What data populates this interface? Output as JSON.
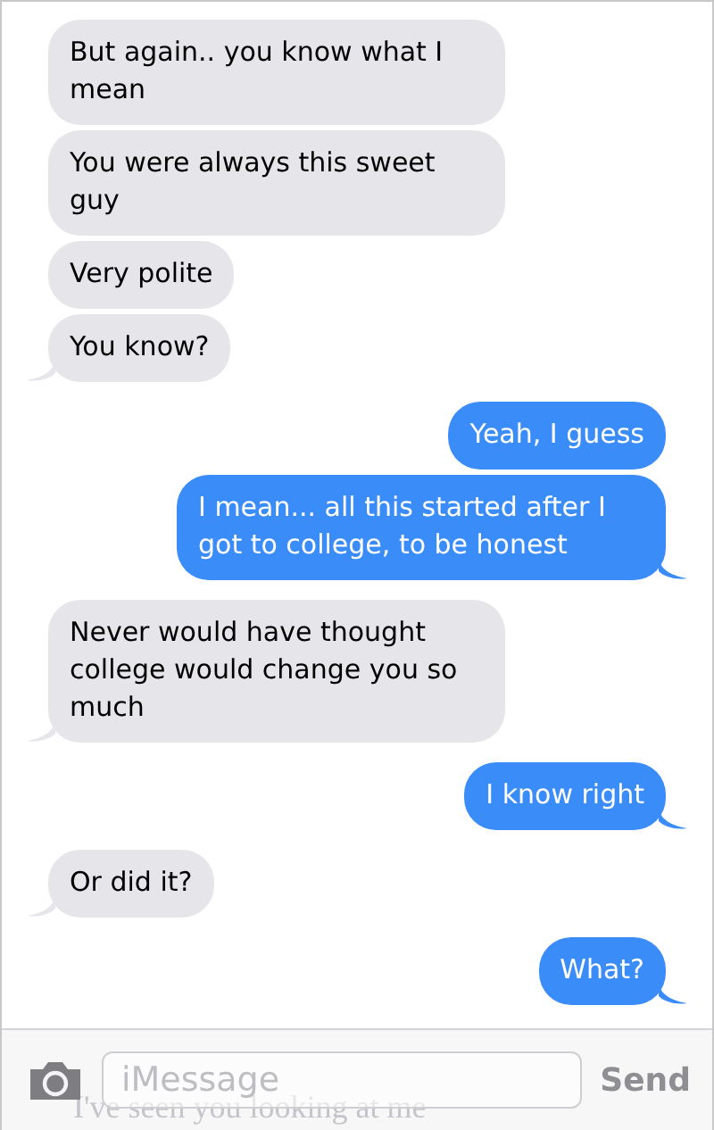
{
  "messages": [
    {
      "sent": false,
      "text": "But again.. you know what I mean",
      "tail": false
    },
    {
      "sent": false,
      "text": "You were always this sweet guy",
      "tail": false
    },
    {
      "sent": false,
      "text": "Very polite",
      "tail": false
    },
    {
      "sent": false,
      "text": "You know?",
      "tail": true
    },
    {
      "sent": true,
      "text": "Yeah, I guess",
      "tail": false
    },
    {
      "sent": true,
      "text": "I mean... all this started after I got to college, to be honest",
      "tail": true
    },
    {
      "sent": false,
      "text": "Never would have thought college would change you so much",
      "tail": true
    },
    {
      "sent": true,
      "text": "I know right",
      "tail": true
    },
    {
      "sent": false,
      "text": "Or did it?",
      "tail": true
    },
    {
      "sent": true,
      "text": "What?",
      "tail": true
    }
  ],
  "compose_bar": {
    "placeholder": "iMessage",
    "send_label": "Send",
    "text_behind_bar": "I've seen you looking at me"
  }
}
